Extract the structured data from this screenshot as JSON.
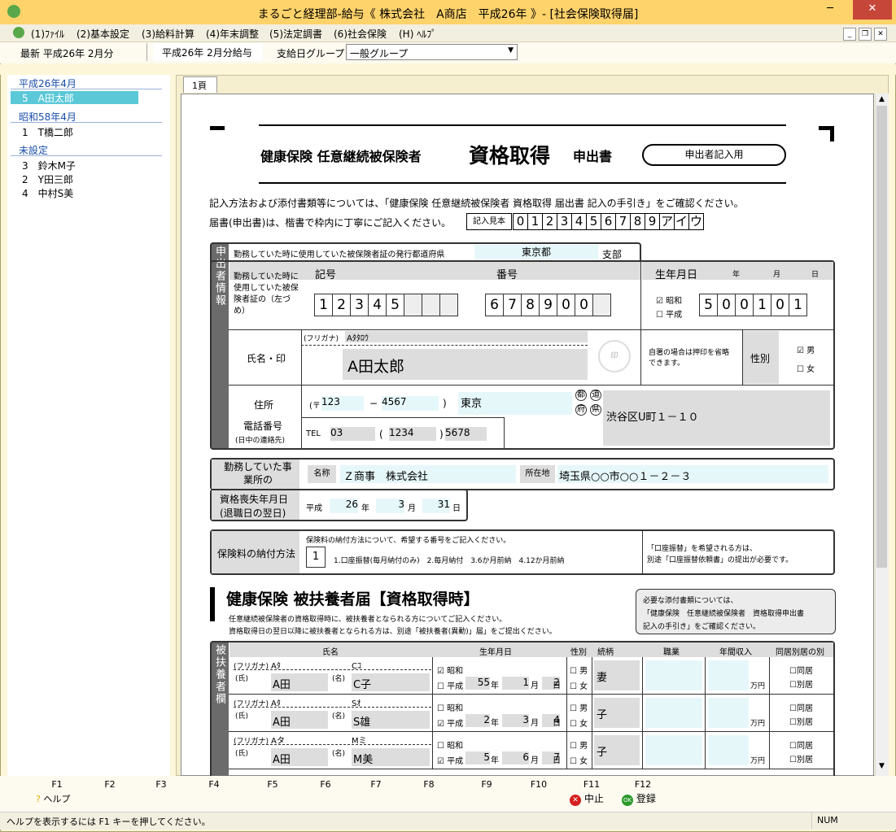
{
  "window": {
    "title": "まるごと経理部-給与《 株式会社　A商店　平成26年 》- [社会保険取得届]"
  },
  "menu": [
    "(1)ﾌｧｲﾙ",
    "(2)基本設定",
    "(3)給料計算",
    "(4)年末調整",
    "(5)法定調書",
    "(6)社会保険",
    "(H) ﾍﾙﾌﾟ"
  ],
  "toolbar": {
    "latest": "最新 平成26年 2月分",
    "payroll": "平成26年 2月分給与",
    "group_label": "支給日グループ",
    "group_value": "一般グループ"
  },
  "sidebar": {
    "groups": [
      {
        "title": "平成26年4月",
        "items": [
          {
            "no": "5",
            "name": "A田太郎"
          }
        ]
      },
      {
        "title": "昭和58年4月",
        "items": [
          {
            "no": "1",
            "name": "T橋二郎"
          }
        ]
      },
      {
        "title": "未設定",
        "items": [
          {
            "no": "3",
            "name": "鈴木M子"
          },
          {
            "no": "2",
            "name": "Y田三郎"
          },
          {
            "no": "4",
            "name": "中村S美"
          }
        ]
      }
    ]
  },
  "tab": "1頁",
  "form": {
    "title_main": "健康保険 任意継続被保険者",
    "title_big": "資格取得",
    "title_suffix": "申出書",
    "badge": "申出者記入用",
    "note1": "記入方法および添付書類等については、「健康保険 任意継続被保険者 資格取得 届出書 記入の手引き」をご確認ください。",
    "note2": "届書(申出書)は、楷書で枠内に丁寧にご記入ください。",
    "sample_label": "記入見本",
    "sample_chars": [
      "0",
      "1",
      "2",
      "3",
      "4",
      "5",
      "6",
      "7",
      "8",
      "9",
      "ア",
      "イ",
      "ウ"
    ],
    "side_label": "申出者情報",
    "pref_label": "勤務していた時に使用していた被保険者証の発行都道府県",
    "pref": "東京都",
    "branch": "支部",
    "card_label": "勤務していた時に使用していた被保険者証の（左づめ）",
    "kigou": "記号",
    "bangou": "番号",
    "kigou_digits": [
      "1",
      "2",
      "3",
      "4",
      "5",
      "",
      "",
      ""
    ],
    "bangou_digits": [
      "6",
      "7",
      "8",
      "9",
      "0",
      "0",
      ""
    ],
    "birth_label": "生年月日",
    "y": "年",
    "m": "月",
    "d": "日",
    "showa": "昭和",
    "heisei": "平成",
    "birth_digits": [
      "5",
      "0",
      "0",
      "1",
      "0",
      "1"
    ],
    "name_label": "氏名・印",
    "furigana_label": "(フリガナ)",
    "furigana": "Aﾀﾀﾛｳ",
    "name": "A田太郎",
    "seal": "印",
    "seal_note": "自署の場合は押印を省略できます。",
    "sex_label": "性別",
    "male": "男",
    "female": "女",
    "address_label": "住所",
    "postal_mark": "(〒",
    "zip1": "123",
    "dash": "−",
    "zip2": "4567",
    "paren_close": ")",
    "pref_addr": "東京",
    "to": "都",
    "do": "道",
    "fu": "府",
    "ken": "県",
    "address": "渋谷区U町１－１０",
    "tel_label": "電話番号",
    "tel_sub": "(日中の連絡先)",
    "tel": "TEL",
    "tel1": "03",
    "tel_open": "(",
    "tel2": "1234",
    "tel_close": ")",
    "tel3": "5678",
    "office_label": "勤務していた事業所の",
    "office_name_label": "名称",
    "office_name": "Ｚ商事　株式会社",
    "office_loc_label": "所在地",
    "office_loc": "埼玉県○○市○○１－２－３",
    "loss_label": "資格喪失年月日",
    "loss_sub": "(退職日の翌日)",
    "loss_era": "平成",
    "loss_y": "26",
    "loss_m": "3",
    "loss_d": "31",
    "pay_label": "保険料の納付方法",
    "pay_note": "保険料の納付方法について、希望する番号をご記入ください。",
    "pay_value": "1",
    "pay_options": "1.口座振替(毎月納付のみ)　2.毎月納付　3.6か月前納　4.12か月前納",
    "pay_right1": "「口座振替」を希望される方は、",
    "pay_right2": "別途「口座振替依頼書」の提出が必要です。",
    "dep_title": "健康保険 被扶養者届【資格取得時】",
    "dep_note1": "任意継続被保険者の資格取得時に、被扶養者となられる方についてご記入ください。",
    "dep_note2": "資格取得日の翌日以降に被扶養者となられる方は、別途「被扶養者(異動)」届」をご提出ください。",
    "dep_box1": "必要な添付書類については、",
    "dep_box2": "「健康保険　任意継続被保険者　資格取得申出書",
    "dep_box3": "記入の手引き」をご確認ください。",
    "dep_side": "被扶養者欄",
    "col_name": "氏名",
    "col_birth": "生年月日",
    "col_sex": "性別",
    "col_rel": "続柄",
    "col_job": "職業",
    "col_income": "年間収入",
    "col_live": "同居別居の別",
    "shi": "(氏)",
    "mei": "(名)",
    "yen": "万円",
    "same": "同居",
    "sep": "別居",
    "deps": [
      {
        "f1": "Aﾀ",
        "f2": "Cｺ",
        "n1": "A田",
        "n2": "C子",
        "era": "showa",
        "y": "55",
        "m": "1",
        "d": "2",
        "sex": "",
        "rel": "妻"
      },
      {
        "f1": "Aﾀ",
        "f2": "Sｵ",
        "n1": "A田",
        "n2": "S雄",
        "era": "heisei",
        "y": "2",
        "m": "3",
        "d": "4",
        "sex": "",
        "rel": "子"
      },
      {
        "f1": "Aタ",
        "f2": "Mミ",
        "n1": "A田",
        "n2": "M美",
        "era": "heisei",
        "y": "5",
        "m": "6",
        "d": "7",
        "sex": "",
        "rel": "子"
      }
    ]
  },
  "fkeys": [
    "F1",
    "F2",
    "F3",
    "F4",
    "F5",
    "F6",
    "F7",
    "F8",
    "F9",
    "F10",
    "F11",
    "F12"
  ],
  "fbuttons": {
    "help": "ヘルプ",
    "stop": "中止",
    "register": "登録"
  },
  "status": {
    "text": "ヘルプを表示するには F1 キーを押してください。",
    "num": "NUM"
  }
}
